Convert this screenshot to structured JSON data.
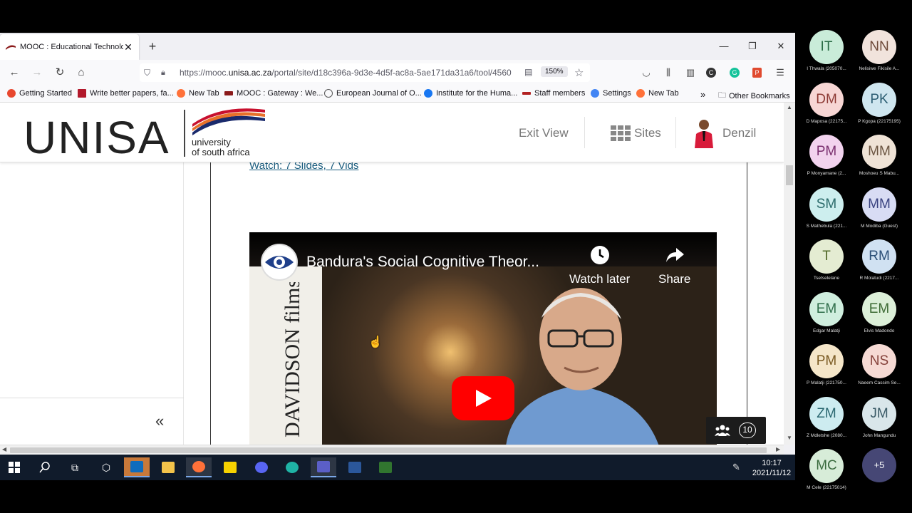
{
  "browser": {
    "tab_title": "MOOC : Educational Technolog",
    "url_prefix": "https://mooc.",
    "url_domain": "unisa.ac.za",
    "url_rest": "/portal/site/d18c396a-9d3e-4d5f-ac8a-5ae171da31a6/tool/4560",
    "zoom": "150%"
  },
  "bookmarks": [
    {
      "label": "Getting Started",
      "color": "#e8472e"
    },
    {
      "label": "Write better papers, fa...",
      "color": "#b2182b"
    },
    {
      "label": "New Tab",
      "color": "#ff7139"
    },
    {
      "label": "MOOC : Gateway : We...",
      "color": "#8b1a1a"
    },
    {
      "label": "European Journal of O...",
      "color": "#555555"
    },
    {
      "label": "Institute for the Huma...",
      "color": "#1877f2"
    },
    {
      "label": "Staff members",
      "color": "#b22222"
    },
    {
      "label": "Settings",
      "color": "#4285f4"
    },
    {
      "label": "New Tab",
      "color": "#ff7139"
    },
    {
      "label": "Other Bookmarks",
      "color": "#555555"
    }
  ],
  "header": {
    "logo_main": "UNISA",
    "logo_sub1": "university",
    "logo_sub2": "of south africa",
    "exit_view": "Exit View",
    "sites": "Sites",
    "user": "Denzil"
  },
  "content": {
    "cut_link": "Watch: 7 Slides, 7 Vids"
  },
  "video": {
    "title": "Bandura's Social Cognitive Theor...",
    "watch_later": "Watch later",
    "share": "Share",
    "side_text": "DAVIDSON films"
  },
  "meeting": {
    "participant_count": "10",
    "more": "+5",
    "participants": [
      {
        "initials": "IT",
        "name": "I Thwala (205070...",
        "bg": "#c9ecd9",
        "fg": "#2a6b45"
      },
      {
        "initials": "NN",
        "name": "Nelisiwe Fikisile A...",
        "bg": "#f1e3dc",
        "fg": "#6e4a3a"
      },
      {
        "initials": "DM",
        "name": "D Maposa (22175...",
        "bg": "#f7d6d4",
        "fg": "#8e3b35"
      },
      {
        "initials": "PK",
        "name": "P Kgopa (22175195)",
        "bg": "#cfe6ef",
        "fg": "#2b5d72"
      },
      {
        "initials": "PM",
        "name": "P Monyamane (2...",
        "bg": "#f2d3ee",
        "fg": "#7a2f6f"
      },
      {
        "initials": "MM",
        "name": "Moshoeu S Mabu...",
        "bg": "#efe3d6",
        "fg": "#6a5440"
      },
      {
        "initials": "SM",
        "name": "S Mathebula (221...",
        "bg": "#cdeeee",
        "fg": "#2b6b6b"
      },
      {
        "initials": "MM",
        "name": "M Modiba (Guest)",
        "bg": "#d8dcf4",
        "fg": "#3a4380"
      },
      {
        "initials": "T",
        "name": "Tsetselelane",
        "bg": "#e4ecd2",
        "fg": "#526a2a"
      },
      {
        "initials": "RM",
        "name": "R Molatudi (2217...",
        "bg": "#d0e1f2",
        "fg": "#2c4f77"
      },
      {
        "initials": "EM",
        "name": "Edgar Malatji",
        "bg": "#cfeede",
        "fg": "#2f6e4b"
      },
      {
        "initials": "EM",
        "name": "Elvis Madondo",
        "bg": "#dcefd8",
        "fg": "#3e6b35"
      },
      {
        "initials": "PM",
        "name": "P Malatji (221750...",
        "bg": "#f5e6c9",
        "fg": "#7a5a22"
      },
      {
        "initials": "NS",
        "name": "Naeem Cassim Se...",
        "bg": "#f6dad4",
        "fg": "#85413a"
      },
      {
        "initials": "ZM",
        "name": "Z Mdletshe (2080...",
        "bg": "#cdecf0",
        "fg": "#2a6770"
      },
      {
        "initials": "JM",
        "name": "John Mangundu",
        "bg": "#d9e6ea",
        "fg": "#3a5a66"
      },
      {
        "initials": "MC",
        "name": "M Cele (22175014)",
        "bg": "#d7ecd8",
        "fg": "#3b6b3f"
      }
    ]
  },
  "taskbar": {
    "time": "10:17",
    "date": "2021/11/12",
    "apps": [
      "start-icon",
      "search-icon",
      "task-view-icon",
      "app-icon",
      "outlook-icon",
      "file-explorer-icon",
      "firefox-icon",
      "sticky-notes-icon",
      "discord-icon",
      "edge-icon",
      "teams-icon",
      "word-icon",
      "project-icon"
    ]
  }
}
